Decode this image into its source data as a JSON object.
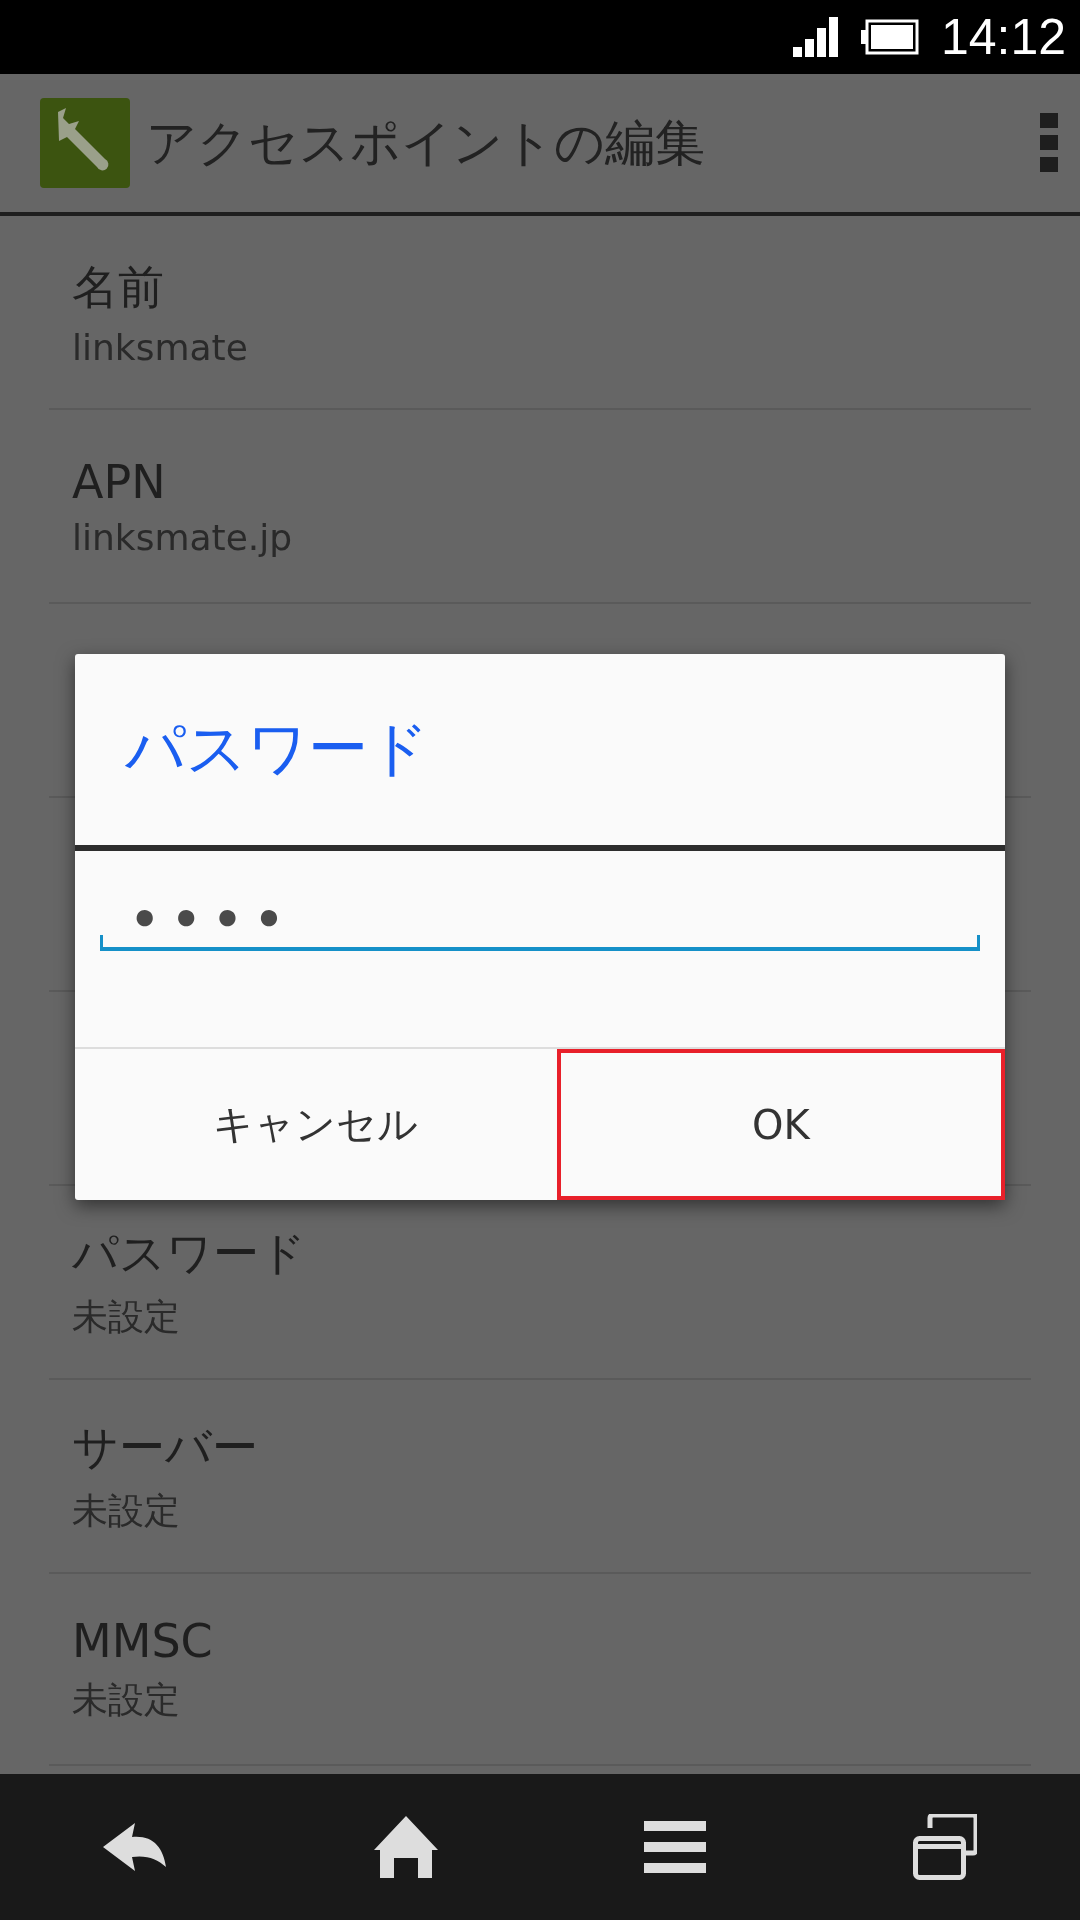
{
  "status_bar": {
    "time": "14:12"
  },
  "action_bar": {
    "title": "アクセスポイントの編集"
  },
  "settings": [
    {
      "kind": "entry",
      "title": "名前",
      "value": "linksmate"
    },
    {
      "kind": "entry",
      "title": "APN",
      "value": "linksmate.jp"
    },
    {
      "kind": "covered"
    },
    {
      "kind": "covered"
    },
    {
      "kind": "covered"
    },
    {
      "kind": "entry",
      "title": "パスワード",
      "value": "未設定"
    },
    {
      "kind": "entry",
      "title": "サーバー",
      "value": "未設定"
    },
    {
      "kind": "entry",
      "title": "MMSC",
      "value": "未設定"
    }
  ],
  "dialog": {
    "title": "パスワード",
    "field_value": "••••",
    "buttons": [
      {
        "label": "キャンセル",
        "highlighted": false
      },
      {
        "label": "OK",
        "highlighted": true
      }
    ]
  }
}
